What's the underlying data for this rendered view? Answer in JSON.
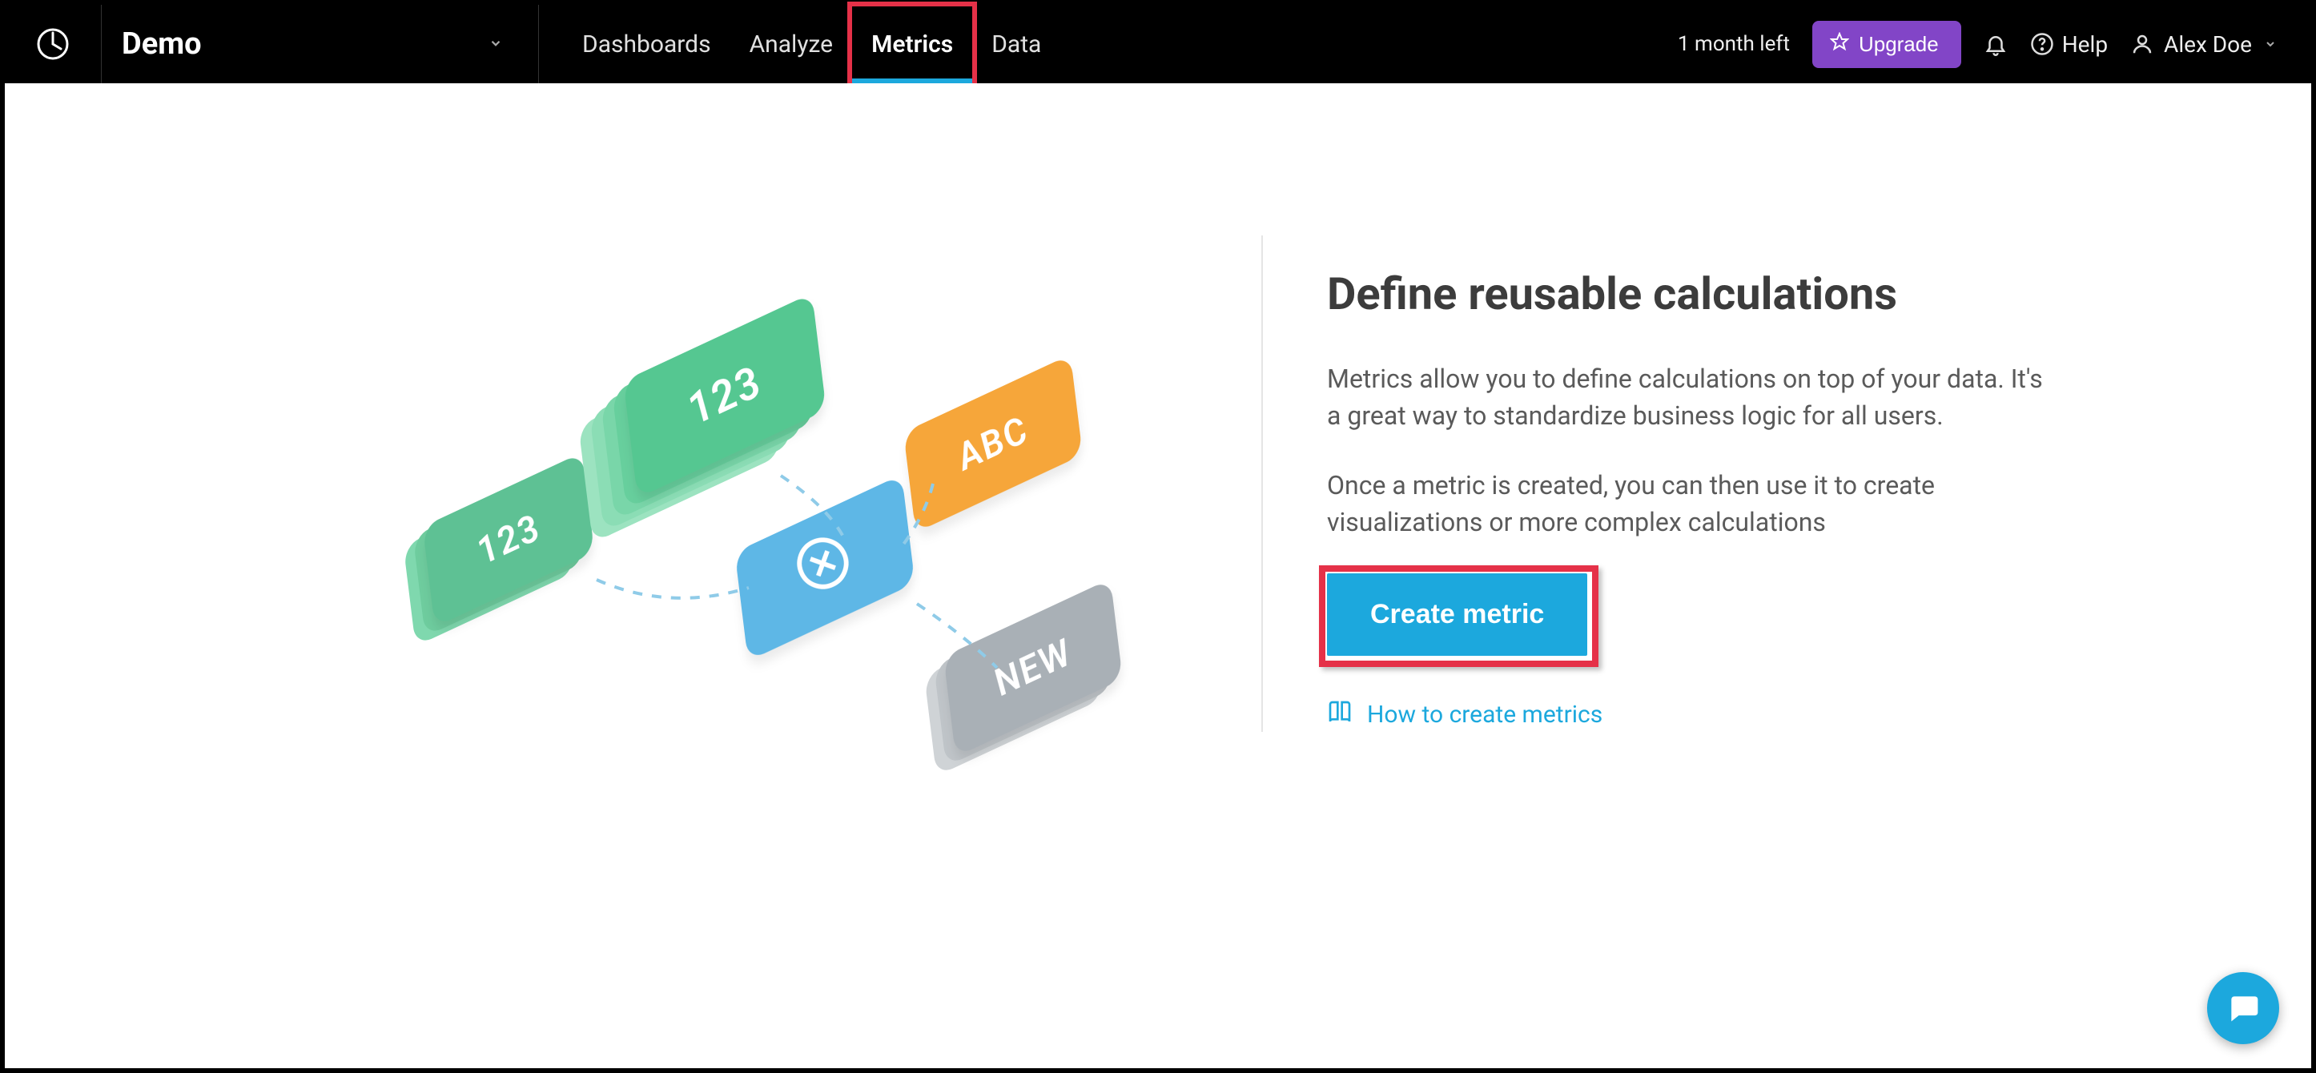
{
  "header": {
    "workspace_name": "Demo",
    "nav": [
      {
        "label": "Dashboards",
        "active": false
      },
      {
        "label": "Analyze",
        "active": false
      },
      {
        "label": "Metrics",
        "active": true,
        "highlighted": true
      },
      {
        "label": "Data",
        "active": false
      }
    ],
    "trial_text": "1 month left",
    "upgrade_label": "Upgrade",
    "help_label": "Help",
    "user_name": "Alex Doe"
  },
  "main": {
    "heading": "Define reusable calculations",
    "paragraph_1": "Metrics allow you to define calculations on top of your data. It's a great way to standardize business logic for all users.",
    "paragraph_2": "Once a metric is created, you can then use it to create visualizations or more complex calculations",
    "cta_label": "Create metric",
    "help_link_label": "How to create metrics"
  },
  "illustration": {
    "tile_numbers_1": "123",
    "tile_numbers_2": "123",
    "tile_abc": "ABC",
    "tile_new": "NEW"
  },
  "colors": {
    "accent": "#1ca8dd",
    "upgrade": "#8245c7",
    "highlight": "#e53148"
  }
}
